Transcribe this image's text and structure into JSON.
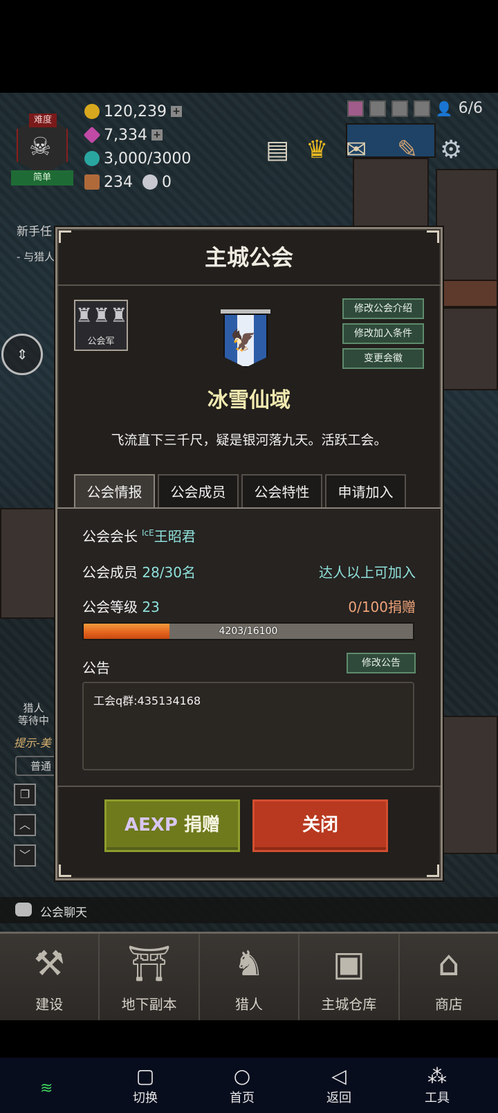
{
  "hud": {
    "difficulty_top": "难度",
    "difficulty_bottom": "简单",
    "gold": "120,239",
    "gems": "7,334",
    "crystals": "3,000/3000",
    "scrolls": "234",
    "orbs": "0",
    "hunters": "6/6",
    "newbie_task": "新手任",
    "task_sub": "- 与猎人"
  },
  "modal": {
    "title": "主城公会",
    "army_label": "公会军",
    "side_buttons": [
      "修改公会介绍",
      "修改加入条件",
      "变更会徽"
    ],
    "guild_name": "冰雪仙域",
    "guild_desc": "飞流直下三千尺，疑是银河落九天。活跃工会。",
    "tabs": [
      "公会情报",
      "公会成员",
      "公会特性",
      "申请加入"
    ],
    "active_tab": 0,
    "leader_label": "公会会长",
    "leader_tag": "IcE",
    "leader_name": "王昭君",
    "members_label": "公会成员",
    "members_value": "28/30名",
    "join_condition": "达人以上可加入",
    "level_label": "公会等级",
    "level_value": "23",
    "donation_progress": "0/100捐赠",
    "xp_text": "4203/16100",
    "xp_fraction": 0.261,
    "notice_label": "公告",
    "notice_edit": "修改公告",
    "notice_text": "工会q群:435134168",
    "donate_prefix": "AEXP",
    "donate_label": "捐赠",
    "close_label": "关闭"
  },
  "chat": {
    "label": "公会聊天",
    "tab_label": "普通",
    "hint_prefix": "提示-美",
    "hunter_waiting": [
      "猎人",
      "等待中"
    ]
  },
  "bottom_menu": [
    {
      "icon": "hammer-icon",
      "label": "建设"
    },
    {
      "icon": "dungeon-gate-icon",
      "label": "地下副本"
    },
    {
      "icon": "hunter-icon",
      "label": "猎人"
    },
    {
      "icon": "chest-icon",
      "label": "主城仓库"
    },
    {
      "icon": "shop-icon",
      "label": "商店"
    }
  ],
  "nav": {
    "switch": "切换",
    "home": "首页",
    "back": "返回",
    "tools": "工具"
  },
  "colors": {
    "accent_teal": "#8fe0da",
    "accent_orange": "#f0a47a",
    "donate_green": "#6e7a1c",
    "close_red": "#b8391f"
  }
}
